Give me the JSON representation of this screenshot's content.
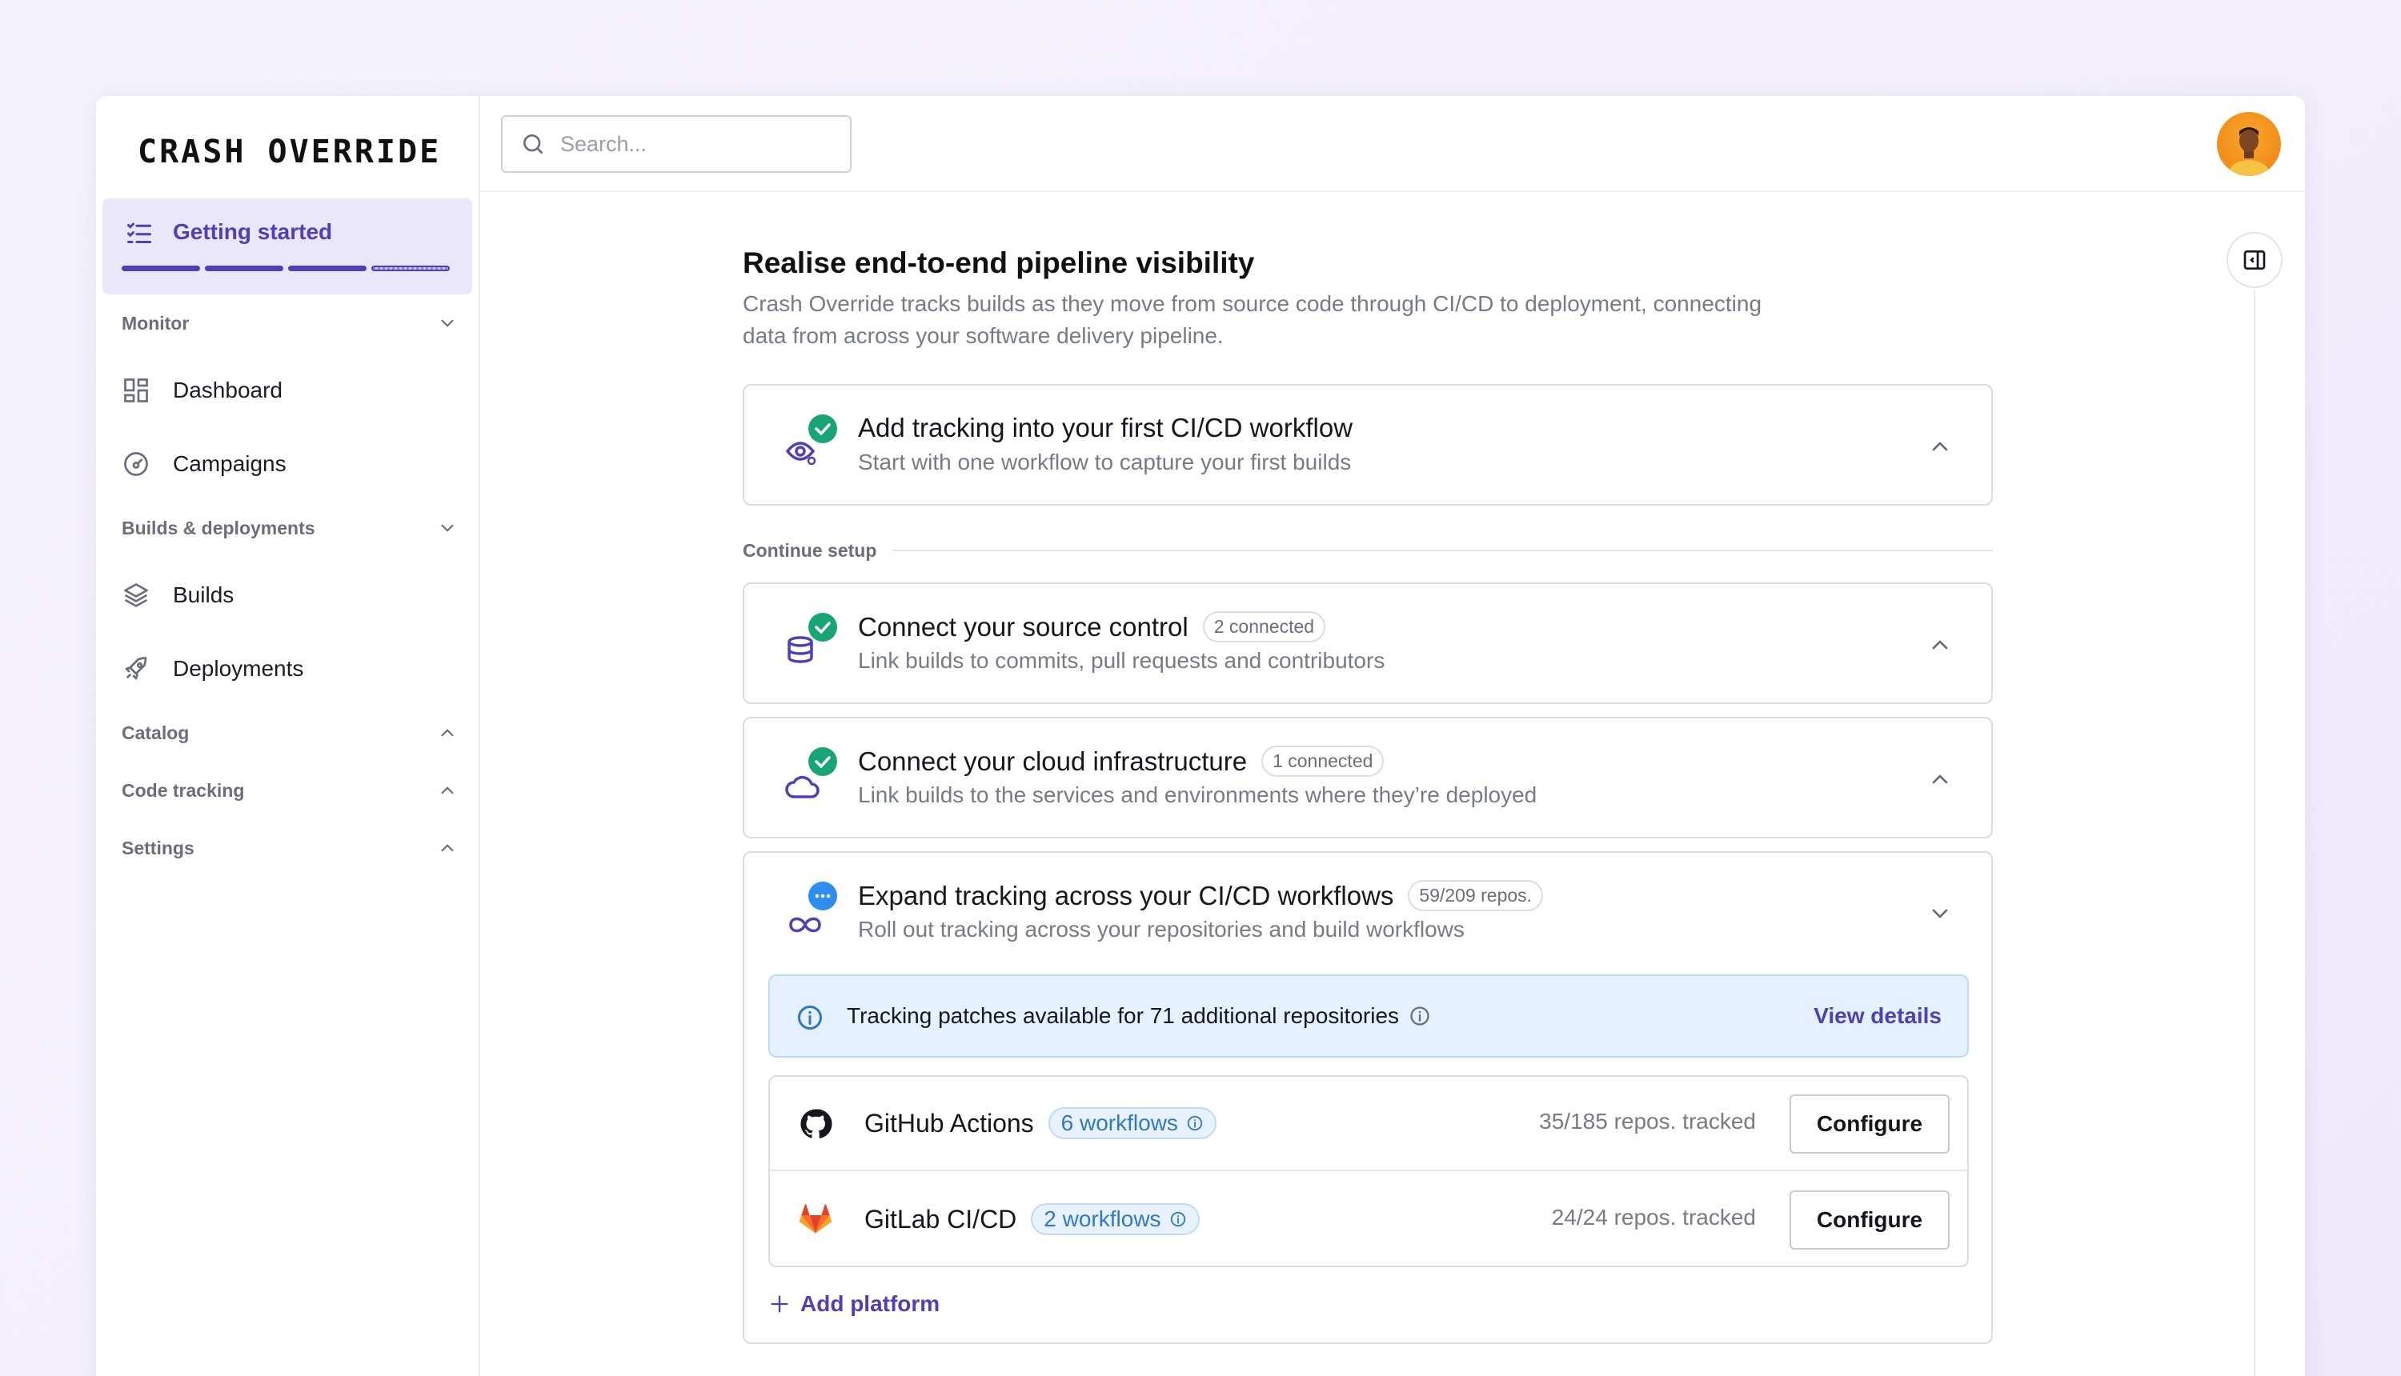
{
  "app": {
    "logo": "CRASH OVERRIDE"
  },
  "sidebar": {
    "getting_started": {
      "label": "Getting started",
      "progress_segments": 4,
      "completed_segments": 3
    },
    "sections": [
      {
        "label": "Monitor",
        "items": [
          {
            "label": "Dashboard",
            "icon": "dashboard-icon"
          },
          {
            "label": "Campaigns",
            "icon": "gauge-icon"
          }
        ]
      },
      {
        "label": "Builds & deployments",
        "items": [
          {
            "label": "Builds",
            "icon": "layers-icon"
          },
          {
            "label": "Deployments",
            "icon": "rocket-icon"
          }
        ]
      },
      {
        "label": "Catalog",
        "items": []
      },
      {
        "label": "Code tracking",
        "items": []
      },
      {
        "label": "Settings",
        "items": []
      }
    ]
  },
  "search": {
    "placeholder": "Search..."
  },
  "main": {
    "title": "Realise end-to-end pipeline visibility",
    "description": "Crash Override tracks builds as they move from source code through CI/CD to deployment, connecting data from across your software delivery pipeline.",
    "first_step": {
      "title": "Add tracking into your first CI/CD workflow",
      "subtitle": "Start with one workflow to capture your first builds",
      "status": "complete"
    },
    "continue_label": "Continue setup",
    "steps": [
      {
        "title": "Connect your source control",
        "badge": "2 connected",
        "subtitle": "Link builds to commits, pull requests and contributors",
        "status": "complete"
      },
      {
        "title": "Connect your cloud infrastructure",
        "badge": "1 connected",
        "subtitle": "Link builds to the services and environments where they’re deployed",
        "status": "complete"
      },
      {
        "title": "Expand tracking across your CI/CD workflows",
        "badge": "59/209 repos.",
        "subtitle": "Roll out tracking across your repositories and build workflows",
        "status": "in-progress"
      }
    ],
    "banner": {
      "text": "Tracking patches available for 71 additional repositories",
      "link": "View details"
    },
    "platforms": [
      {
        "name": "GitHub Actions",
        "workflows": "6 workflows",
        "tracked": "35/185 repos. tracked",
        "action": "Configure",
        "icon": "github-icon"
      },
      {
        "name": "GitLab CI/CD",
        "workflows": "2 workflows",
        "tracked": "24/24 repos. tracked",
        "action": "Configure",
        "icon": "gitlab-icon"
      }
    ],
    "add_platform": "Add platform"
  },
  "colors": {
    "accent": "#4f3fb8",
    "success": "#17a673",
    "info": "#2f78c8",
    "progress": "#2d8ef0"
  }
}
